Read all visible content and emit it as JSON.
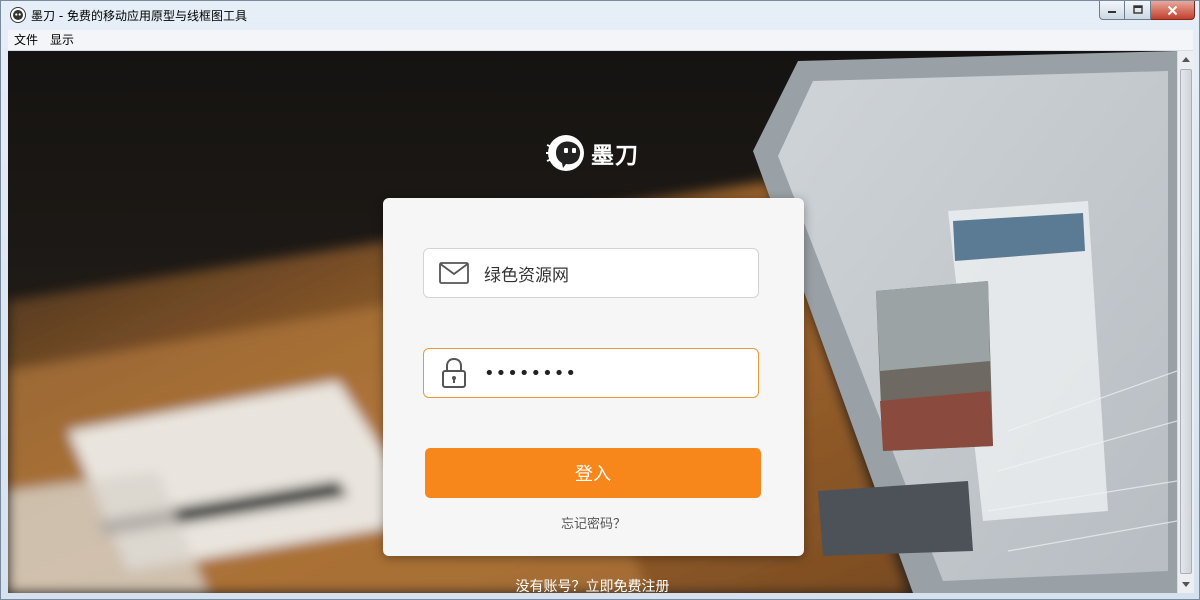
{
  "window": {
    "title": "墨刀 - 免费的移动应用原型与线框图工具"
  },
  "menu": {
    "items": [
      "文件",
      "显示"
    ]
  },
  "logo": {
    "text": "墨刀"
  },
  "login": {
    "username_value": "绿色资源网",
    "password_value": "••••••••",
    "submit_label": "登入",
    "forgot_label": "忘记密码？"
  },
  "footer": {
    "register_label": "没有账号？立即免费注册"
  },
  "colors": {
    "accent": "#f7871b",
    "focus_border": "#e49a3e"
  },
  "icons": {
    "username": "mail-icon",
    "password": "lock-icon"
  }
}
